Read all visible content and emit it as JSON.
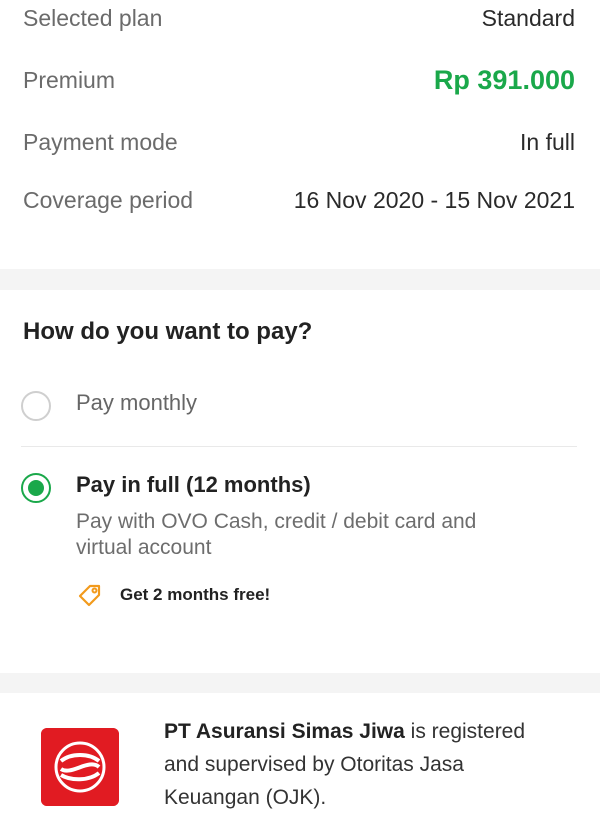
{
  "summary": {
    "rows": [
      {
        "label": "Selected plan",
        "value": "Standard"
      },
      {
        "label": "Premium",
        "value": "Rp 391.000"
      },
      {
        "label": "Payment mode",
        "value": "In full"
      },
      {
        "label": "Coverage period",
        "value": "16 Nov 2020 - 15 Nov 2021"
      }
    ],
    "premium_color": "#1aa84a"
  },
  "payment": {
    "title": "How do you want to pay?",
    "options": [
      {
        "label": "Pay monthly",
        "selected": false
      },
      {
        "label": "Pay in full (12 months)",
        "selected": true,
        "description": "Pay with OVO Cash, credit / debit card and virtual account",
        "promo": "Get 2 months free!",
        "promo_icon": "tag-icon"
      }
    ],
    "accent_color": "#1aa84a"
  },
  "footer": {
    "company": "PT Asuransi Simas Jiwa",
    "text": " is registered and supervised by Otoritas Jasa Keuangan (OJK).",
    "logo_icon": "simas-logo-icon"
  }
}
